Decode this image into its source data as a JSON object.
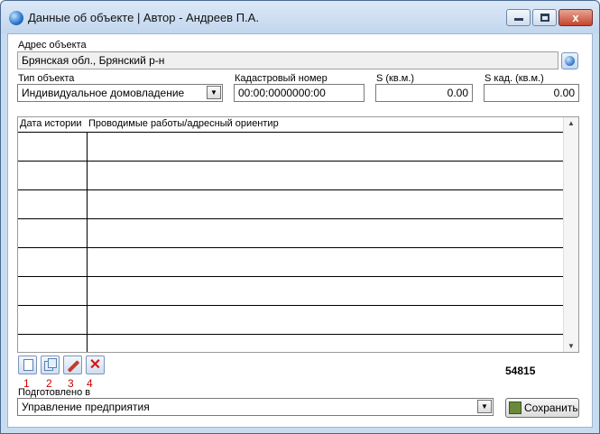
{
  "window": {
    "title": "Данные об объекте | Автор - Андреев П.А.",
    "min_symbol": "",
    "max_symbol": "",
    "close_symbol": "x"
  },
  "address": {
    "label": "Адрес объекта",
    "value": "Брянская обл., Брянский р-н"
  },
  "object_type": {
    "label": "Тип объекта",
    "value": "Индивидуальное домовладение"
  },
  "cadastral": {
    "label": "Кадастровый номер",
    "value": "00:00:0000000:00"
  },
  "area": {
    "label": "S (кв.м.)",
    "value": "0.00"
  },
  "cad_area": {
    "label": "S кад. (кв.м.)",
    "value": "0.00"
  },
  "history_grid": {
    "columns": [
      "Дата истории",
      "Проводимые работы/адресный ориентир"
    ],
    "rows": [
      {
        "date": "",
        "work": ""
      },
      {
        "date": "",
        "work": ""
      },
      {
        "date": "",
        "work": ""
      },
      {
        "date": "",
        "work": ""
      },
      {
        "date": "",
        "work": ""
      },
      {
        "date": "",
        "work": ""
      },
      {
        "date": "",
        "work": ""
      },
      {
        "date": "",
        "work": ""
      }
    ]
  },
  "toolbar": {
    "annotations": [
      "1",
      "2",
      "3",
      "4"
    ],
    "icons": [
      "new-document-icon",
      "copy-document-icon",
      "pencil-icon",
      "delete-icon"
    ]
  },
  "record_id": "54815",
  "prepared_in": {
    "label": "Подготовлено в",
    "value": "Управление предприятия"
  },
  "save_button": {
    "label": "Сохранить"
  },
  "colors": {
    "annotation": "#d00000",
    "close_button": "#c4452c",
    "title_bar": "#c2d6ee"
  }
}
